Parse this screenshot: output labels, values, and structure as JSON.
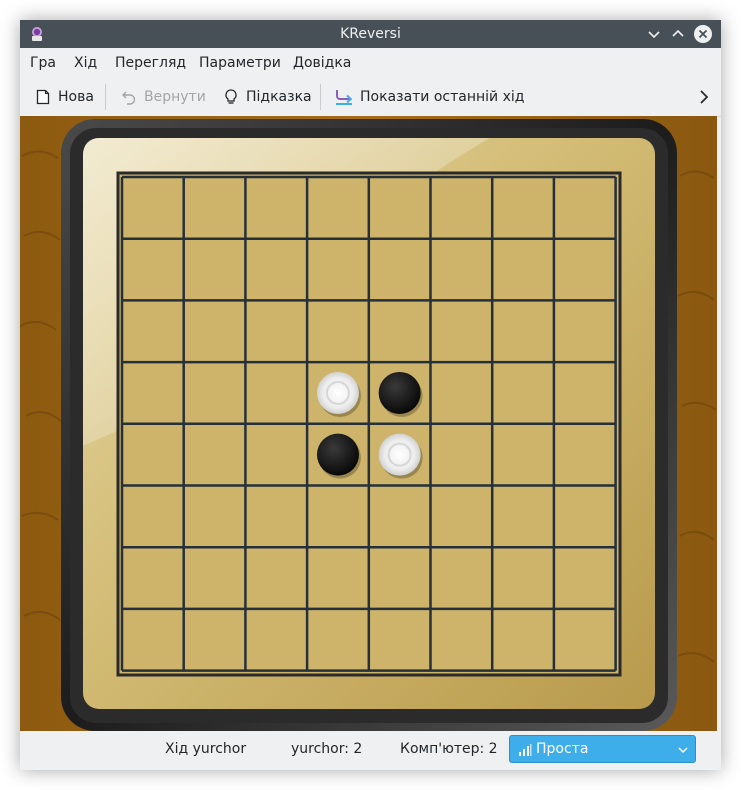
{
  "window": {
    "title": "KReversi"
  },
  "menu": [
    "Гра",
    "Хід",
    "Перегляд",
    "Параметри",
    "Довідка"
  ],
  "toolbar": {
    "new_label": "Нова",
    "undo_label": "Вернути",
    "hint_label": "Підказка",
    "last_move_label": "Показати останній хід"
  },
  "board": {
    "rows": 8,
    "cols": 8,
    "stones": [
      {
        "row": 3,
        "col": 3,
        "color": "white"
      },
      {
        "row": 3,
        "col": 4,
        "color": "black"
      },
      {
        "row": 4,
        "col": 3,
        "color": "black"
      },
      {
        "row": 4,
        "col": 4,
        "color": "white"
      }
    ]
  },
  "status": {
    "turn": "Хід yurchor",
    "player_score": "yurchor: 2",
    "computer_score": "Комп'ютер: 2",
    "difficulty": "Проста"
  },
  "colors": {
    "titlebar": "#475057",
    "accent": "#3daee9",
    "wood": "#9a6415",
    "board": "#cdb46a"
  }
}
